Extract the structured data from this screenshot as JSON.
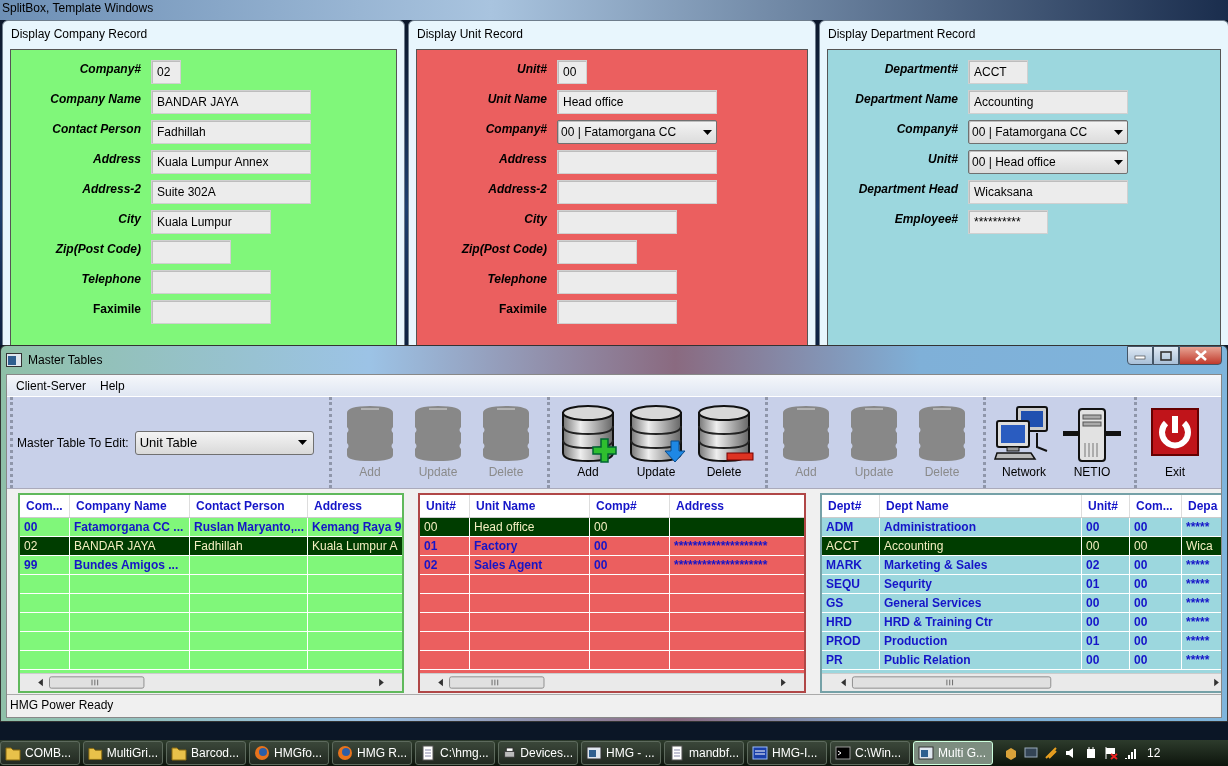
{
  "desktop": {
    "title": "SplitBox, Template Windows"
  },
  "record_windows": [
    {
      "title": "Display Company Record",
      "color": "#80f77a",
      "fields": [
        {
          "label": "Company#",
          "value": "02",
          "kind": "text"
        },
        {
          "label": "Company Name",
          "value": "BANDAR JAYA",
          "kind": "text"
        },
        {
          "label": "Contact Person",
          "value": "Fadhillah",
          "kind": "text"
        },
        {
          "label": "Address",
          "value": "Kuala Lumpur Annex",
          "kind": "text"
        },
        {
          "label": "Address-2",
          "value": "Suite 302A",
          "kind": "text"
        },
        {
          "label": "City",
          "value": "Kuala Lumpur",
          "kind": "text"
        },
        {
          "label": "Zip(Post Code)",
          "kind": "text"
        },
        {
          "label": "Telephone",
          "kind": "text"
        },
        {
          "label": "Faximile",
          "kind": "text"
        }
      ]
    },
    {
      "title": "Display Unit Record",
      "color": "#eb5f5f",
      "fields": [
        {
          "label": "Unit#",
          "value": "00",
          "kind": "text"
        },
        {
          "label": "Unit Name",
          "value": "Head office",
          "kind": "text"
        },
        {
          "label": "Company#",
          "value": "00 | Fatamorgana CC",
          "kind": "select"
        },
        {
          "label": "Address",
          "kind": "text"
        },
        {
          "label": "Address-2",
          "kind": "text"
        },
        {
          "label": "City",
          "kind": "text"
        },
        {
          "label": "Zip(Post Code)",
          "kind": "text"
        },
        {
          "label": "Telephone",
          "kind": "text"
        },
        {
          "label": "Faximile",
          "kind": "text"
        }
      ]
    },
    {
      "title": "Display Department Record",
      "color": "#9cd7de",
      "fields": [
        {
          "label": "Department#",
          "value": "ACCT",
          "kind": "text"
        },
        {
          "label": "Department Name",
          "value": "Accounting",
          "kind": "text"
        },
        {
          "label": "Company#",
          "value": "00 | Fatamorgana CC",
          "kind": "select"
        },
        {
          "label": "Unit#",
          "value": "00 | Head office",
          "kind": "select"
        },
        {
          "label": "Department Head",
          "value": "Wicaksana",
          "kind": "text"
        },
        {
          "label": "Employee#",
          "value": "**********",
          "kind": "text"
        }
      ]
    }
  ],
  "master_window": {
    "title": "Master Tables",
    "menu": [
      "Client-Server",
      "Help"
    ],
    "selector": {
      "label": "Master Table To Edit:",
      "value": "Unit Table"
    },
    "toolbar_groups": [
      {
        "buttons": [
          {
            "label": "Add",
            "kind": "add",
            "disabled": true
          },
          {
            "label": "Update",
            "kind": "update",
            "disabled": true
          },
          {
            "label": "Delete",
            "kind": "delete",
            "disabled": true
          }
        ]
      },
      {
        "buttons": [
          {
            "label": "Add",
            "kind": "add",
            "disabled": false
          },
          {
            "label": "Update",
            "kind": "update",
            "disabled": false
          },
          {
            "label": "Delete",
            "kind": "delete",
            "disabled": false
          }
        ]
      },
      {
        "buttons": [
          {
            "label": "Add",
            "kind": "add",
            "disabled": true
          },
          {
            "label": "Update",
            "kind": "update",
            "disabled": true
          },
          {
            "label": "Delete",
            "kind": "delete",
            "disabled": true
          }
        ]
      },
      {
        "buttons": [
          {
            "label": "Network",
            "kind": "network",
            "disabled": false
          },
          {
            "label": "NETIO",
            "kind": "server",
            "disabled": false
          }
        ]
      },
      {
        "buttons": [
          {
            "label": "Exit",
            "kind": "exit",
            "disabled": false
          }
        ]
      }
    ],
    "grids": [
      {
        "color": "#80f77a",
        "columns": [
          "Com...",
          "Company Name",
          "Contact Person",
          "Address"
        ],
        "rows": [
          {
            "cells": [
              "00",
              "Fatamorgana CC ...",
              "Ruslan Maryanto,...",
              "Kemang Raya 9"
            ],
            "selected": false
          },
          {
            "cells": [
              "02",
              "BANDAR JAYA",
              "Fadhillah",
              "Kuala Lumpur A"
            ],
            "selected": true
          },
          {
            "cells": [
              "99",
              "Bundes Amigos   ...",
              null,
              null
            ],
            "selected": false
          }
        ]
      },
      {
        "color": "#eb5f5f",
        "columns": [
          "Unit#",
          "Unit Name",
          "Comp#",
          "Address"
        ],
        "rows": [
          {
            "cells": [
              "00",
              "Head office",
              "00",
              null
            ],
            "selected": true
          },
          {
            "cells": [
              "01",
              "Factory",
              "00",
              "********************"
            ],
            "selected": false
          },
          {
            "cells": [
              "02",
              "Sales Agent",
              "00",
              "********************"
            ],
            "selected": false
          }
        ]
      },
      {
        "color": "#9cd7de",
        "columns": [
          "Dept#",
          "Dept Name",
          "Unit#",
          "Com...",
          "Depa"
        ],
        "rows": [
          {
            "cells": [
              "ADM",
              "Administratioon",
              "00",
              "00",
              "*****"
            ],
            "selected": false
          },
          {
            "cells": [
              "ACCT",
              "Accounting",
              "00",
              "00",
              "Wica"
            ],
            "selected": true
          },
          {
            "cells": [
              "MARK",
              "Marketing & Sales",
              "02",
              "00",
              "*****"
            ],
            "selected": false
          },
          {
            "cells": [
              "SEQU",
              "Sequrity",
              "01",
              "00",
              "*****"
            ],
            "selected": false
          },
          {
            "cells": [
              "GS",
              "General Services",
              "00",
              "00",
              "*****"
            ],
            "selected": false
          },
          {
            "cells": [
              "HRD",
              "HRD & Training Ctr",
              "00",
              "00",
              "*****"
            ],
            "selected": false
          },
          {
            "cells": [
              "PROD",
              "Production",
              "01",
              "00",
              "*****"
            ],
            "selected": false
          },
          {
            "cells": [
              "PR",
              "Public Relation",
              "00",
              "00",
              "*****"
            ],
            "selected": false
          }
        ]
      }
    ],
    "status_bar": "HMG Power Ready"
  },
  "taskbar": {
    "items": [
      {
        "label": "COMB...",
        "kind": "folder",
        "selected": false
      },
      {
        "label": "MultiGri...",
        "kind": "folder",
        "selected": false
      },
      {
        "label": "Barcod...",
        "kind": "folder",
        "selected": false
      },
      {
        "label": "HMGfo...",
        "kind": "browser",
        "selected": false
      },
      {
        "label": "HMG R...",
        "kind": "browser",
        "selected": false
      },
      {
        "label": "C:\\hmg...",
        "kind": "notepad",
        "selected": false
      },
      {
        "label": "Devices...",
        "kind": "printer",
        "selected": false
      },
      {
        "label": "HMG - ...",
        "kind": "window",
        "selected": false
      },
      {
        "label": "mandbf...",
        "kind": "notepad",
        "selected": false
      },
      {
        "label": "HMG-I...",
        "kind": "app",
        "selected": false
      },
      {
        "label": "C:\\Win...",
        "kind": "console",
        "selected": false
      },
      {
        "label": "Multi G...",
        "kind": "window",
        "selected": true
      }
    ],
    "clock": "12"
  }
}
